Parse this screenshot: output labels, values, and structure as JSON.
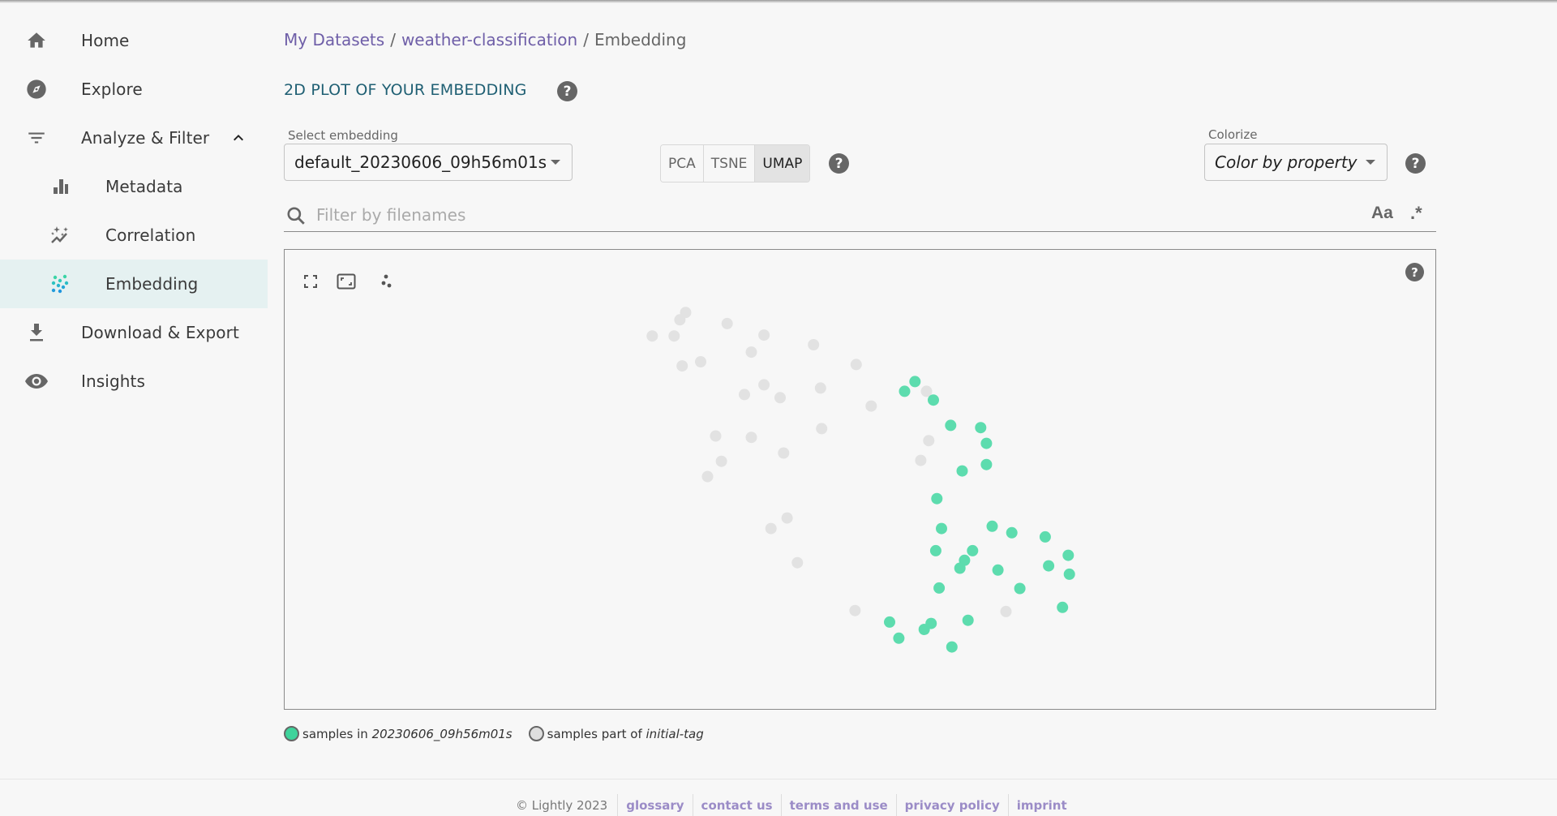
{
  "sidebar": {
    "items": [
      {
        "label": "Home",
        "icon": "home-icon"
      },
      {
        "label": "Explore",
        "icon": "compass-icon"
      },
      {
        "label": "Analyze & Filter",
        "icon": "filter-icon",
        "expanded": true
      },
      {
        "label": "Metadata",
        "icon": "bar-chart-icon"
      },
      {
        "label": "Correlation",
        "icon": "sparkle-chart-icon"
      },
      {
        "label": "Embedding",
        "icon": "scatter-dots-icon",
        "active": true
      },
      {
        "label": "Download & Export",
        "icon": "download-icon"
      },
      {
        "label": "Insights",
        "icon": "eye-icon"
      }
    ]
  },
  "breadcrumb": {
    "items": [
      "My Datasets",
      "weather-classification",
      "Embedding"
    ],
    "separator": "/"
  },
  "section": {
    "title": "2D PLOT OF YOUR EMBEDDING",
    "help": "?"
  },
  "embedding_select": {
    "label": "Select embedding",
    "value": "default_20230606_09h56m01s"
  },
  "projection": {
    "options": [
      "PCA",
      "TSNE",
      "UMAP"
    ],
    "selected": "UMAP",
    "help": "?"
  },
  "colorize": {
    "label": "Colorize",
    "value": "Color by property",
    "help": "?"
  },
  "filter": {
    "placeholder": "Filter by filenames",
    "value": "",
    "case_toggle": "Aa",
    "regex_toggle": ".*"
  },
  "plot": {
    "tools": [
      "fullscreen-icon",
      "fit-view-icon",
      "scatter-select-icon"
    ],
    "help": "?"
  },
  "colors": {
    "selected": "#5ddcae",
    "other": "#e2e2e2",
    "accent": "#6f5fa8",
    "title": "#1f5f73"
  },
  "legend": [
    {
      "prefix": "samples in ",
      "name": "20230606_09h56m01s",
      "color": "#3ed39b"
    },
    {
      "prefix": "samples part of ",
      "name": "initial-tag",
      "color": "#dedede"
    }
  ],
  "chart_data": {
    "type": "scatter",
    "title": "2D PLOT OF YOUR EMBEDDING",
    "projection": "UMAP",
    "xlim": [
      0,
      1
    ],
    "ylim": [
      0,
      1
    ],
    "y_direction": "top-down",
    "grid": false,
    "series": [
      {
        "name": "samples part of initial-tag",
        "color": "#e2e2e2",
        "points": [
          [
            0.348,
            0.136
          ],
          [
            0.343,
            0.152
          ],
          [
            0.319,
            0.187
          ],
          [
            0.338,
            0.187
          ],
          [
            0.384,
            0.16
          ],
          [
            0.416,
            0.185
          ],
          [
            0.405,
            0.222
          ],
          [
            0.459,
            0.206
          ],
          [
            0.496,
            0.249
          ],
          [
            0.345,
            0.252
          ],
          [
            0.361,
            0.243
          ],
          [
            0.416,
            0.293
          ],
          [
            0.399,
            0.314
          ],
          [
            0.43,
            0.321
          ],
          [
            0.465,
            0.3
          ],
          [
            0.509,
            0.339
          ],
          [
            0.374,
            0.404
          ],
          [
            0.405,
            0.407
          ],
          [
            0.466,
            0.388
          ],
          [
            0.433,
            0.441
          ],
          [
            0.379,
            0.459
          ],
          [
            0.367,
            0.492
          ],
          [
            0.557,
            0.307
          ],
          [
            0.559,
            0.414
          ],
          [
            0.552,
            0.457
          ],
          [
            0.436,
            0.582
          ],
          [
            0.422,
            0.605
          ],
          [
            0.445,
            0.679
          ],
          [
            0.495,
            0.783
          ],
          [
            0.626,
            0.785
          ]
        ]
      },
      {
        "name": "samples in 20230606_09h56m01s",
        "color": "#5ddcae",
        "points": [
          [
            0.547,
            0.286
          ],
          [
            0.538,
            0.307
          ],
          [
            0.563,
            0.326
          ],
          [
            0.578,
            0.381
          ],
          [
            0.604,
            0.386
          ],
          [
            0.609,
            0.42
          ],
          [
            0.609,
            0.466
          ],
          [
            0.588,
            0.48
          ],
          [
            0.566,
            0.54
          ],
          [
            0.57,
            0.605
          ],
          [
            0.614,
            0.6
          ],
          [
            0.631,
            0.614
          ],
          [
            0.66,
            0.623
          ],
          [
            0.565,
            0.653
          ],
          [
            0.597,
            0.653
          ],
          [
            0.59,
            0.674
          ],
          [
            0.586,
            0.691
          ],
          [
            0.619,
            0.695
          ],
          [
            0.68,
            0.663
          ],
          [
            0.663,
            0.686
          ],
          [
            0.681,
            0.704
          ],
          [
            0.568,
            0.734
          ],
          [
            0.638,
            0.735
          ],
          [
            0.675,
            0.776
          ],
          [
            0.525,
            0.808
          ],
          [
            0.561,
            0.811
          ],
          [
            0.555,
            0.824
          ],
          [
            0.593,
            0.804
          ],
          [
            0.533,
            0.843
          ],
          [
            0.579,
            0.862
          ]
        ]
      }
    ]
  },
  "footer": {
    "copyright": "© Lightly 2023",
    "links": [
      "glossary",
      "contact us",
      "terms and use",
      "privacy policy",
      "imprint"
    ]
  }
}
